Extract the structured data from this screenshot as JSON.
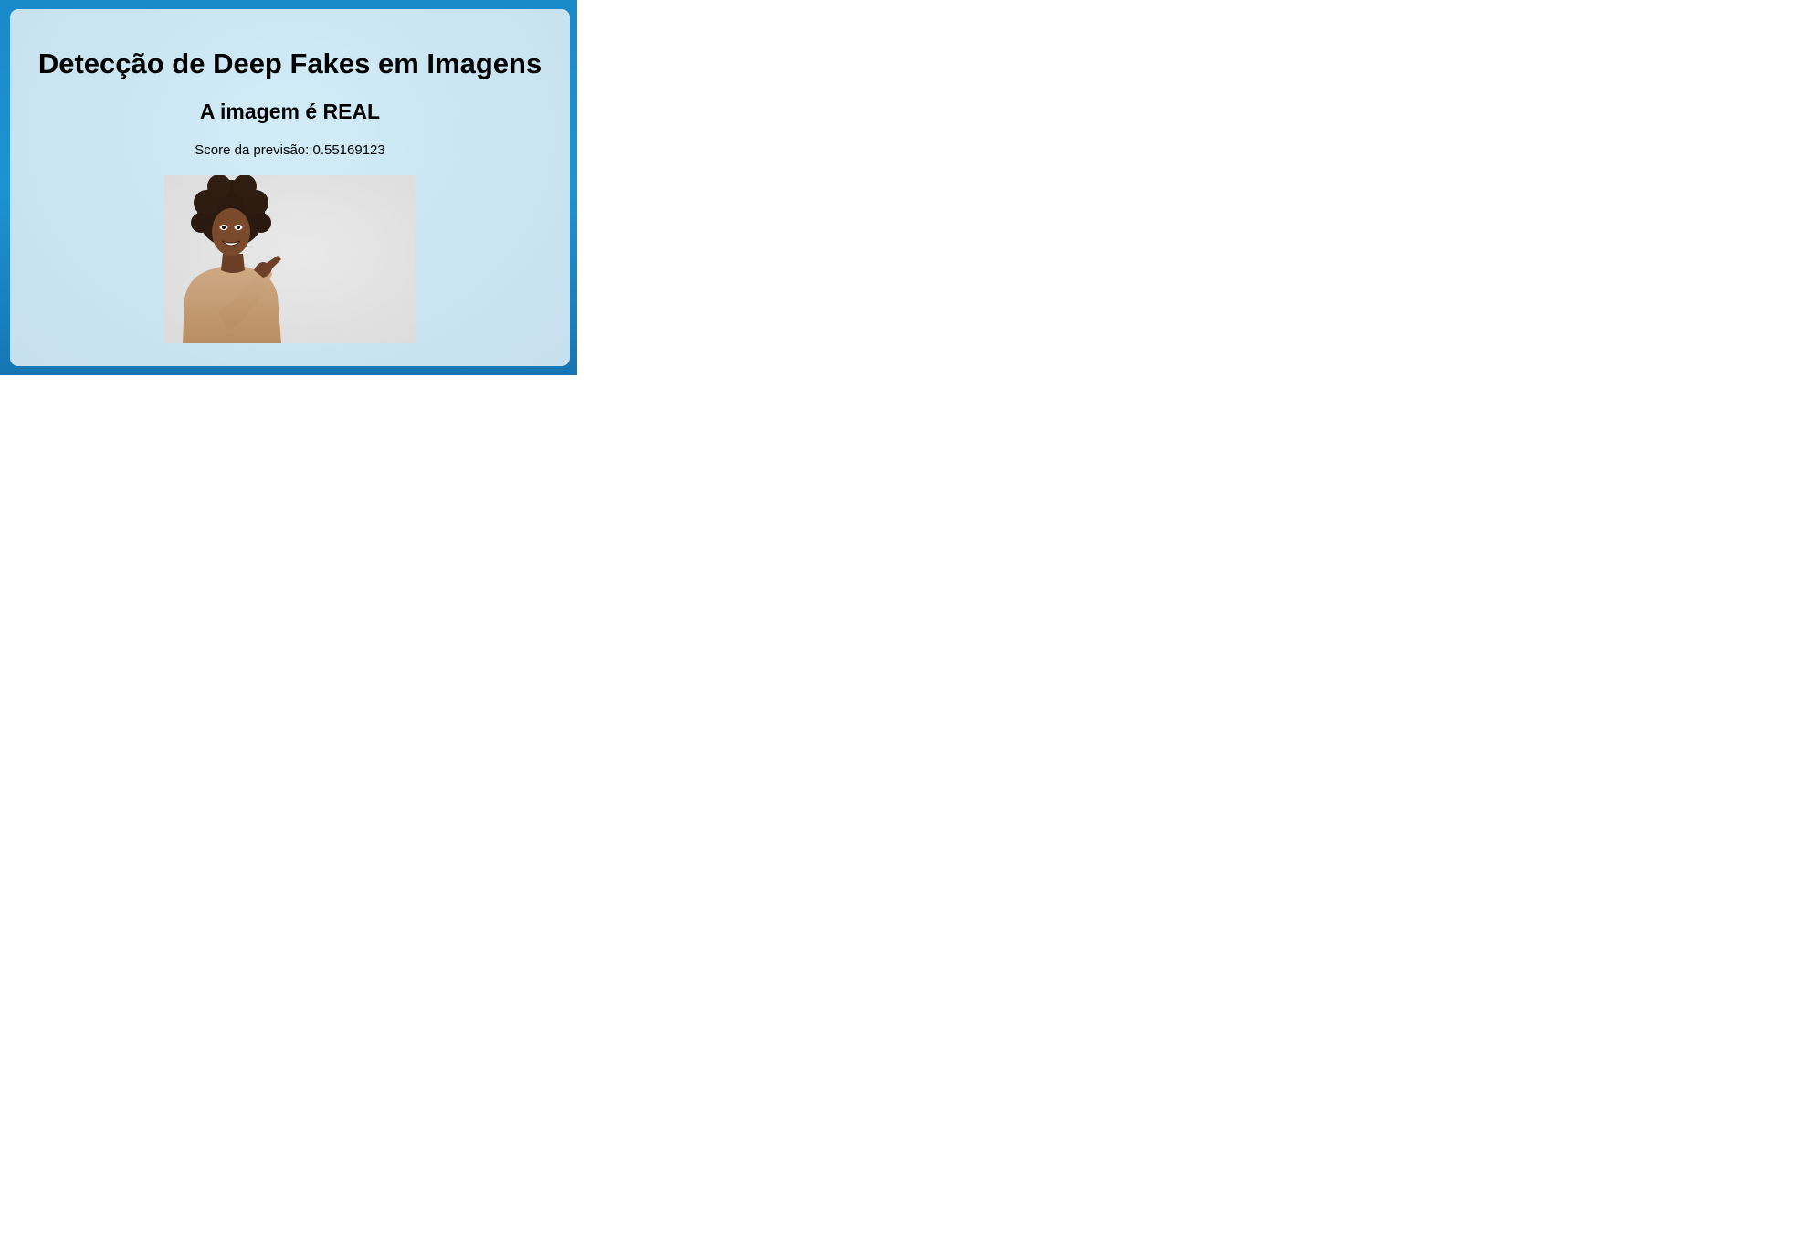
{
  "page": {
    "title": "Detecção de Deep Fakes em Imagens",
    "result": "A imagem é REAL",
    "score_label": "Score da previsão: 0.55169123"
  },
  "image": {
    "alt": "Uploaded photo: smiling woman with curly hair in a beige sweater pointing to the side on a light gray background"
  },
  "colors": {
    "frame_blue": "#1a8ac9",
    "card_background": "#cbe6f3",
    "photo_background": "#e3e3e3",
    "sweater": "#c9a27a"
  }
}
